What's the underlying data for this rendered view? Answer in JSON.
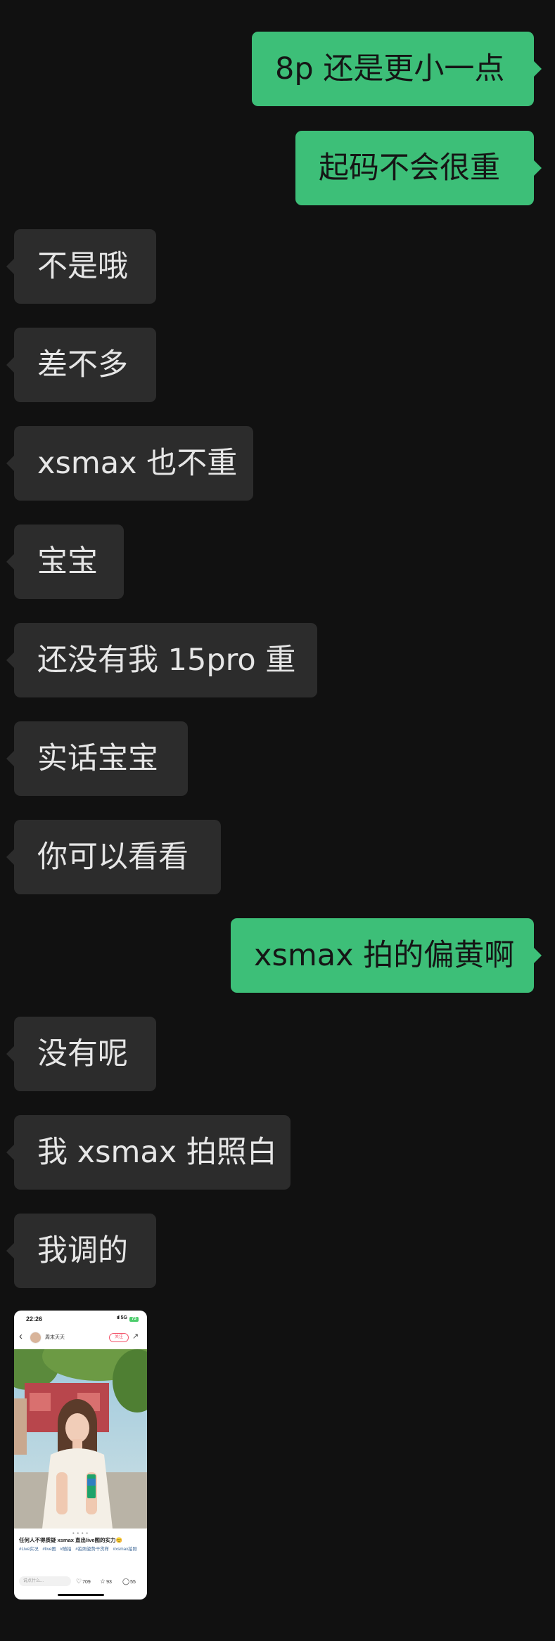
{
  "messages": [
    {
      "side": "out",
      "text": "8p 还是更小一点"
    },
    {
      "side": "out",
      "text": "起码不会很重"
    },
    {
      "side": "in",
      "text": "不是哦"
    },
    {
      "side": "in",
      "text": "差不多"
    },
    {
      "side": "in",
      "text": "xsmax 也不重"
    },
    {
      "side": "in",
      "text": "宝宝"
    },
    {
      "side": "in",
      "text": "还没有我 15pro 重"
    },
    {
      "side": "in",
      "text": "实话宝宝"
    },
    {
      "side": "in",
      "text": "你可以看看"
    },
    {
      "side": "out",
      "text": "xsmax 拍的偏黄啊"
    },
    {
      "side": "in",
      "text": "没有呢"
    },
    {
      "side": "in",
      "text": "我 xsmax 拍照白"
    },
    {
      "side": "in",
      "text": "我调的"
    }
  ],
  "shared_screenshot": {
    "status_time": "22:26",
    "status_signal": "ııl",
    "status_network": "5G",
    "status_battery": "73",
    "author": "周末天天",
    "follow_label": "关注",
    "back_icon": "chevron-left-icon",
    "share_icon": "share-icon",
    "caption": "任何人不得质疑 xsmax 直出live图的实力😊",
    "tags": [
      "#Live实况",
      "#live图",
      "#随拍",
      "#拍照姿势干货样",
      "#xsmax拍照"
    ],
    "comment_placeholder": "说点什么...",
    "likes": "709",
    "favorites": "93",
    "comments": "55",
    "colors": {
      "follow": "#f3556b",
      "tag": "#3e6796"
    }
  },
  "colors": {
    "background": "#111111",
    "incoming_bubble": "#2c2c2c",
    "outgoing_bubble": "#3dbf78"
  }
}
